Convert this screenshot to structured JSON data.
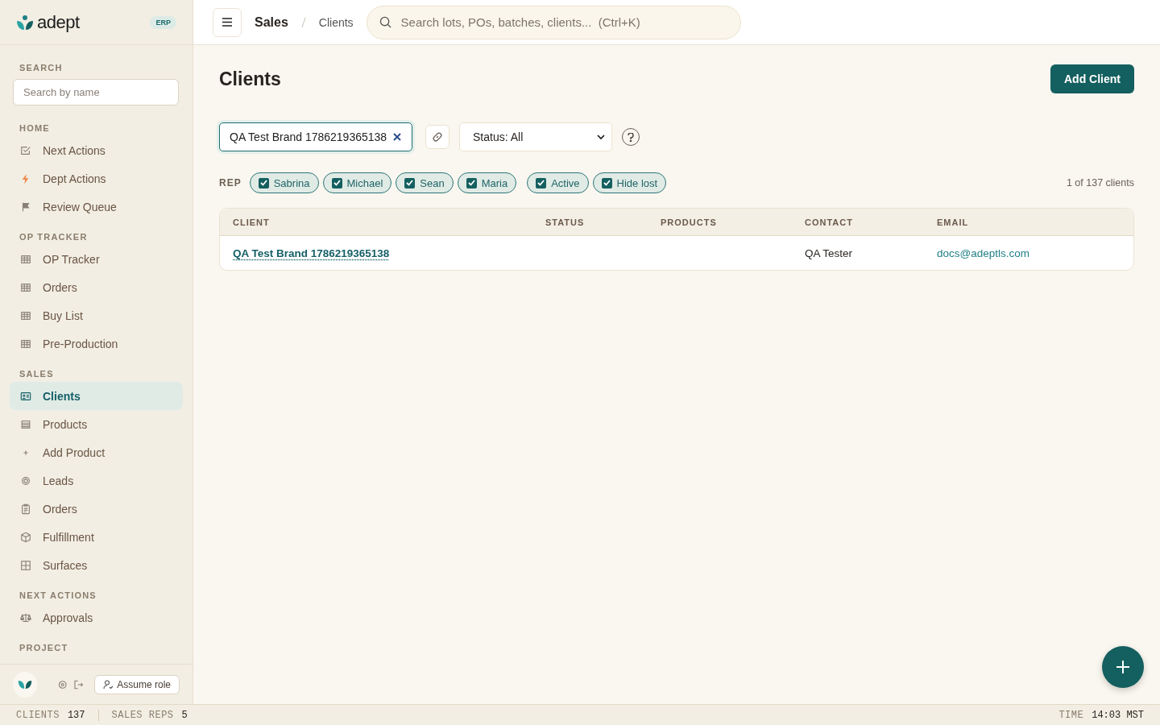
{
  "brand": {
    "name": "adept",
    "badge": "ERP"
  },
  "sidebar": {
    "search_label": "SEARCH",
    "search_placeholder": "Search by name",
    "sections": [
      {
        "title": "HOME",
        "items": [
          {
            "label": "Next Actions",
            "kind": "check",
            "selected": false
          },
          {
            "label": "Dept Actions",
            "kind": "bolt",
            "selected": false
          },
          {
            "label": "Review Queue",
            "kind": "flag",
            "selected": false
          }
        ]
      },
      {
        "title": "OP TRACKER",
        "items": [
          {
            "label": "OP Tracker",
            "kind": "grid",
            "selected": false
          },
          {
            "label": "Orders",
            "kind": "grid",
            "selected": false
          },
          {
            "label": "Buy List",
            "kind": "grid",
            "selected": false
          },
          {
            "label": "Pre-Production",
            "kind": "grid",
            "selected": false
          }
        ]
      },
      {
        "title": "SALES",
        "items": [
          {
            "label": "Clients",
            "kind": "card",
            "selected": true
          },
          {
            "label": "Products",
            "kind": "list",
            "selected": false
          },
          {
            "label": "Add Product",
            "kind": "plus",
            "selected": false
          },
          {
            "label": "Leads",
            "kind": "target",
            "selected": false
          },
          {
            "label": "Orders",
            "kind": "clipboard",
            "selected": false
          },
          {
            "label": "Fulfillment",
            "kind": "box",
            "selected": false
          },
          {
            "label": "Surfaces",
            "kind": "squares",
            "selected": false
          }
        ]
      },
      {
        "title": "NEXT ACTIONS",
        "items": [
          {
            "label": "Approvals",
            "kind": "scales",
            "selected": false
          }
        ]
      },
      {
        "title": "PROJECT"
      }
    ],
    "assume_role": "Assume role"
  },
  "topbar": {
    "breadcrumb": [
      "Sales",
      "Clients"
    ],
    "search_placeholder": "Search lots, POs, batches, clients...  (Ctrl+K)"
  },
  "page": {
    "title": "Clients",
    "add_button": "Add Client"
  },
  "filters": {
    "search_value": "QA Test Brand 1786219365138",
    "status_select": "Status: All",
    "rep_label": "REP",
    "rep_chips": [
      {
        "label": "Sabrina",
        "checked": true
      },
      {
        "label": "Michael",
        "checked": true
      },
      {
        "label": "Sean",
        "checked": true
      },
      {
        "label": "Maria",
        "checked": true
      }
    ],
    "toggles": [
      {
        "label": "Active",
        "checked": true
      },
      {
        "label": "Hide lost",
        "checked": true
      }
    ],
    "count": "1 of 137 clients"
  },
  "table": {
    "columns": [
      "CLIENT",
      "STATUS",
      "PRODUCTS",
      "CONTACT",
      "EMAIL"
    ],
    "rows": [
      {
        "client": "QA Test Brand 1786219365138",
        "contact": "QA Tester",
        "email": "docs@adeptls.com"
      }
    ]
  },
  "status_bar": {
    "left": [
      {
        "label": "CLIENTS",
        "value": "137"
      },
      {
        "label": "SALES REPS",
        "value": "5"
      }
    ],
    "right": {
      "label": "TIME",
      "value": "14:03 MST"
    }
  }
}
